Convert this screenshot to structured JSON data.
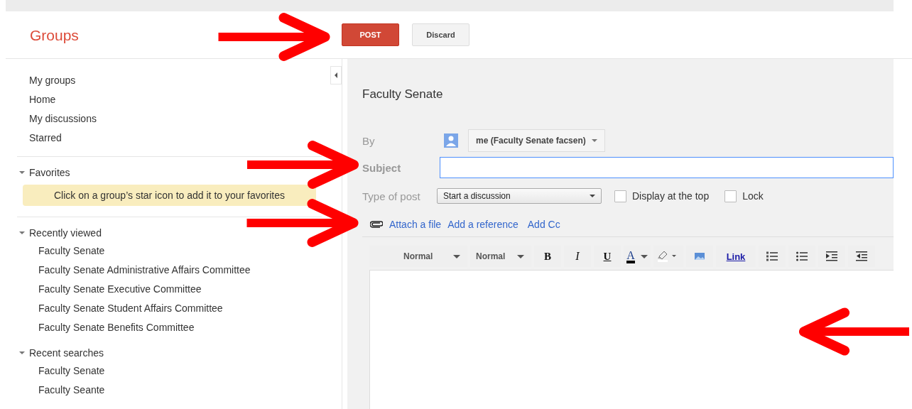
{
  "header": {
    "title": "Groups",
    "buttons": [
      {
        "label": "POST",
        "kind": "primary"
      },
      {
        "label": "Discard",
        "kind": "secondary"
      }
    ]
  },
  "sidebar": {
    "nav": [
      "My groups",
      "Home",
      "My discussions",
      "Starred"
    ],
    "sections": [
      {
        "title": "Favorites",
        "expanded": true,
        "note": "Click on a group’s star icon to add it to your favorites"
      },
      {
        "title": "Recently viewed",
        "expanded": true,
        "items": [
          "Faculty Senate",
          "Faculty Senate Administrative Affairs Committee",
          "Faculty Senate Executive Committee",
          "Faculty Senate Student Affairs Committee",
          "Faculty Senate Benefits Committee"
        ]
      },
      {
        "title": "Recent searches",
        "expanded": true,
        "items": [
          "Faculty Senate",
          "Faculty Seante"
        ]
      }
    ]
  },
  "compose": {
    "group": "Faculty Senate",
    "by_label": "By",
    "author": "me (Faculty Senate facsen)",
    "subject_label": "Subject",
    "type_label": "Type of post",
    "post_type": "Start a discussion",
    "options": [
      {
        "label": "Display at the top",
        "checked": false
      },
      {
        "label": "Lock",
        "checked": false
      }
    ],
    "links": [
      "Attach a file",
      "Add a reference",
      "Add Cc"
    ],
    "toolbar": [
      {
        "kind": "select",
        "label": "Normal"
      },
      {
        "kind": "select",
        "label": "Normal"
      },
      {
        "kind": "bold",
        "label": "B"
      },
      {
        "kind": "italic",
        "label": "I"
      },
      {
        "kind": "underline",
        "label": "U"
      },
      {
        "kind": "font-color",
        "label": "A"
      },
      {
        "kind": "highlight"
      },
      {
        "kind": "image"
      },
      {
        "kind": "link",
        "label": "Link"
      },
      {
        "kind": "numbered-list"
      },
      {
        "kind": "bulleted-list"
      },
      {
        "kind": "indent"
      },
      {
        "kind": "outdent"
      }
    ]
  },
  "annotation_arrows": [
    {
      "points_left": false
    },
    {
      "points_left": false
    },
    {
      "points_left": false
    },
    {
      "points_left": true
    }
  ]
}
